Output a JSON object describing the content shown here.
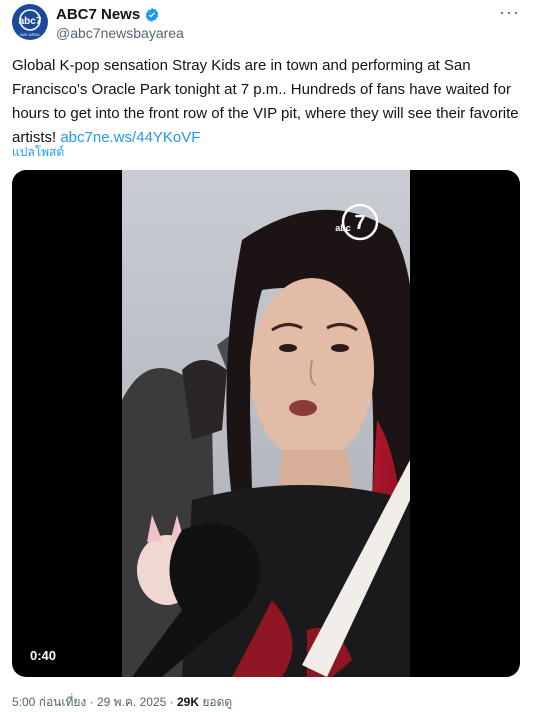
{
  "author": {
    "display_name": "ABC7 News",
    "handle": "@abc7newsbayarea",
    "avatar_logo": "abc7",
    "avatar_caption": "BAY AREA",
    "verified": true
  },
  "tweet": {
    "text": "Global K-pop sensation Stray Kids are in town and performing at San Francisco's Oracle Park tonight at 7 p.m.. Hundreds of fans have waited for hours to get into the front row of the VIP pit, where they will see their favorite artists! ",
    "link": "abc7ne.ws/44YKoVF",
    "translate_label": "แปลโพสต์"
  },
  "media": {
    "duration": "0:40",
    "watermark": "abc"
  },
  "footer": {
    "time": "5:00 ก่อนเที่ยง",
    "separator": "·",
    "date": "29 พ.ค. 2025",
    "views_count": "29K",
    "views_label": "ยอดดู"
  },
  "icons": {
    "more": "more-icon",
    "verified": "verified-badge-icon"
  },
  "colors": {
    "link": "#1d9bf0",
    "secondary_text": "#536471",
    "verified": "#1d9bf0",
    "avatar_bg": "#1b4a9c"
  }
}
